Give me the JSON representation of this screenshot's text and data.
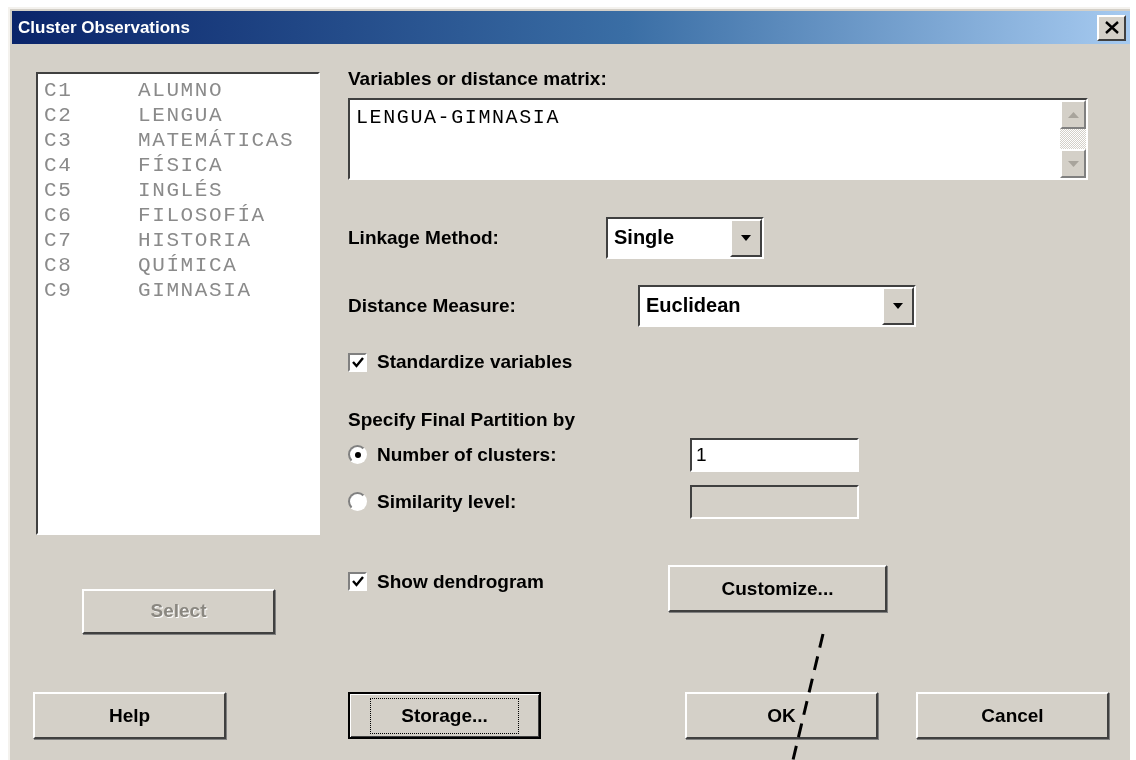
{
  "window": {
    "title": "Cluster Observations"
  },
  "column_list": [
    {
      "column": "C1",
      "name": "ALUMNO"
    },
    {
      "column": "C2",
      "name": "LENGUA"
    },
    {
      "column": "C3",
      "name": "MATEMÁTICAS"
    },
    {
      "column": "C4",
      "name": "FÍSICA"
    },
    {
      "column": "C5",
      "name": "INGLÉS"
    },
    {
      "column": "C6",
      "name": "FILOSOFÍA"
    },
    {
      "column": "C7",
      "name": "HISTORIA"
    },
    {
      "column": "C8",
      "name": "QUÍMICA"
    },
    {
      "column": "C9",
      "name": "GIMNASIA"
    }
  ],
  "select_button": {
    "label": "Select",
    "disabled": true
  },
  "variables": {
    "label": "Variables or distance matrix:",
    "value": "LENGUA-GIMNASIA"
  },
  "linkage": {
    "label": "Linkage Method:",
    "value": "Single"
  },
  "distance": {
    "label": "Distance Measure:",
    "value": "Euclidean"
  },
  "standardize": {
    "label": "Standardize variables",
    "checked": true
  },
  "partition": {
    "heading": "Specify Final Partition by",
    "options": [
      {
        "label": "Number of clusters:",
        "selected": true,
        "value": "1",
        "disabled": false
      },
      {
        "label": "Similarity level:",
        "selected": false,
        "disabled": true
      }
    ]
  },
  "dendrogram": {
    "label": "Show dendrogram",
    "checked": true
  },
  "customize_button": {
    "label": "Customize...",
    "focused": false
  },
  "bottom_buttons": [
    {
      "label": "Help",
      "focused": false
    },
    {
      "label": "Storage...",
      "focused": true
    },
    {
      "label": "OK",
      "focused": false
    },
    {
      "label": "Cancel",
      "focused": false
    }
  ]
}
